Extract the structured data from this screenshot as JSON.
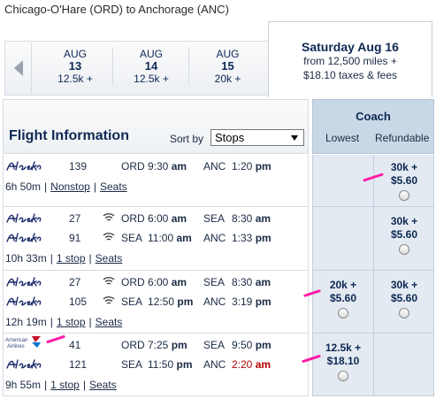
{
  "route": "Chicago-O'Hare (ORD) to Anchorage (ANC)",
  "dates": [
    {
      "month": "AUG",
      "day": "13",
      "price": "12.5k +"
    },
    {
      "month": "AUG",
      "day": "14",
      "price": "12.5k +"
    },
    {
      "month": "AUG",
      "day": "15",
      "price": "20k +"
    }
  ],
  "selected_date": {
    "title": "Saturday Aug 16",
    "line1": "from 12,500 miles +",
    "line2": "$18.10 taxes & fees"
  },
  "header": {
    "title": "Flight Information",
    "sort_label": "Sort by",
    "sort_value": "Stops"
  },
  "coach": {
    "title": "Coach",
    "lowest": "Lowest",
    "refundable": "Refundable"
  },
  "flights": [
    {
      "legs": [
        {
          "airline": "Alaska",
          "num": "139",
          "wifi": false,
          "dep": "ORD",
          "dep_time": "9:30",
          "dep_ampm": "am",
          "arr": "ANC",
          "arr_time": "1:20",
          "arr_ampm": "pm"
        }
      ],
      "duration": "6h 50m",
      "stops": "Nonstop",
      "seats": "Seats",
      "lowest": null,
      "refundable": {
        "miles": "30k +",
        "fee": "$5.60"
      }
    },
    {
      "legs": [
        {
          "airline": "Alaska",
          "num": "27",
          "wifi": true,
          "dep": "ORD",
          "dep_time": "6:00",
          "dep_ampm": "am",
          "arr": "SEA",
          "arr_time": "8:30",
          "arr_ampm": "am"
        },
        {
          "airline": "Alaska",
          "num": "91",
          "wifi": true,
          "dep": "SEA",
          "dep_time": "11:00",
          "dep_ampm": "am",
          "arr": "ANC",
          "arr_time": "1:33",
          "arr_ampm": "pm"
        }
      ],
      "duration": "10h 33m",
      "stops": "1 stop",
      "seats": "Seats",
      "lowest": null,
      "refundable": {
        "miles": "30k +",
        "fee": "$5.60"
      }
    },
    {
      "legs": [
        {
          "airline": "Alaska",
          "num": "27",
          "wifi": true,
          "dep": "ORD",
          "dep_time": "6:00",
          "dep_ampm": "am",
          "arr": "SEA",
          "arr_time": "8:30",
          "arr_ampm": "am"
        },
        {
          "airline": "Alaska",
          "num": "105",
          "wifi": true,
          "dep": "SEA",
          "dep_time": "12:50",
          "dep_ampm": "pm",
          "arr": "ANC",
          "arr_time": "3:19",
          "arr_ampm": "pm"
        }
      ],
      "duration": "12h 19m",
      "stops": "1 stop",
      "seats": "Seats",
      "lowest": {
        "miles": "20k +",
        "fee": "$5.60"
      },
      "refundable": {
        "miles": "30k +",
        "fee": "$5.60"
      }
    },
    {
      "legs": [
        {
          "airline": "American Airlines",
          "num": "41",
          "wifi": false,
          "dep": "ORD",
          "dep_time": "7:25",
          "dep_ampm": "pm",
          "arr": "SEA",
          "arr_time": "9:50",
          "arr_ampm": "pm"
        },
        {
          "airline": "Alaska",
          "num": "121",
          "wifi": false,
          "dep": "SEA",
          "dep_time": "11:50",
          "dep_ampm": "pm",
          "arr": "ANC",
          "arr_time": "2:20",
          "arr_ampm": "am",
          "arr_red": true
        }
      ],
      "duration": "9h 55m",
      "stops": "1 stop",
      "seats": "Seats",
      "lowest": {
        "miles": "12.5k +",
        "fee": "$18.10"
      },
      "refundable": null
    }
  ],
  "colors": {
    "navy": "#0d2854",
    "fare_bg": "#e3eaf1",
    "coach_header": "#c9d8e6",
    "highlight": "#ff1aa8",
    "late_arrival": "#b40000"
  }
}
